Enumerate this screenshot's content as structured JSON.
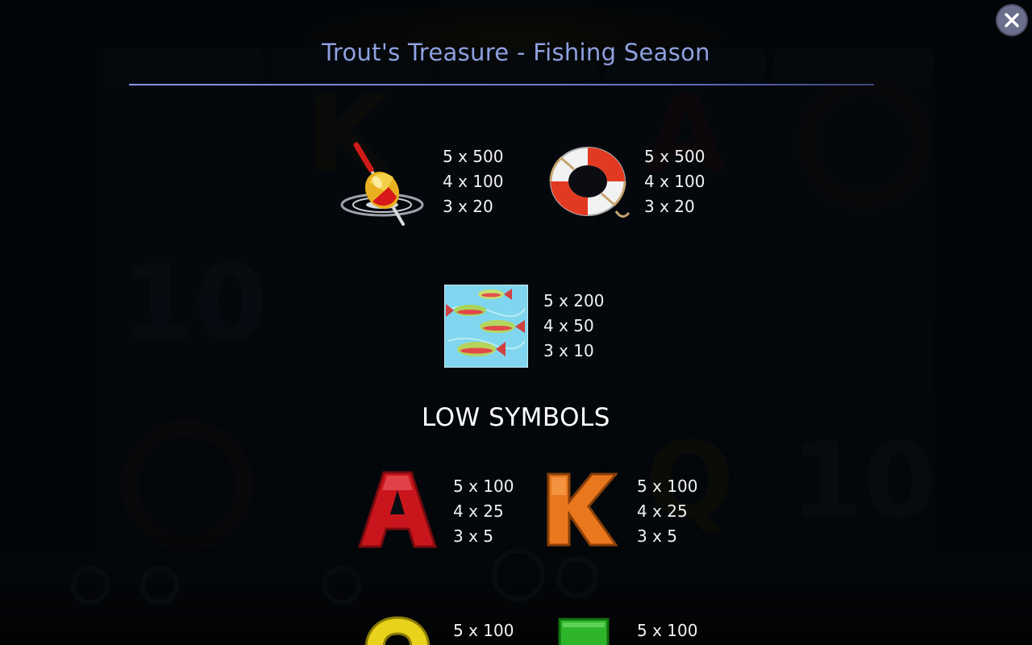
{
  "game": {
    "title": "Trout's Treasure - Fishing Season",
    "close_icon": "close-icon"
  },
  "high_symbols": [
    {
      "icon": "fishing-float-icon",
      "pays": [
        "5 x 500",
        "4 x 100",
        "3 x 20"
      ]
    },
    {
      "icon": "lifebuoy-icon",
      "pays": [
        "5 x 500",
        "4 x 100",
        "3 x 20"
      ]
    },
    {
      "icon": "trout-fish-icon",
      "pays": [
        "5 x 200",
        "4 x 50",
        "3 x 10"
      ]
    }
  ],
  "low_section": {
    "title": "LOW SYMBOLS"
  },
  "low_symbols": [
    {
      "letter": "A",
      "color": "#c8161c",
      "pays": [
        "5 x 100",
        "4 x 25",
        "3 x 5"
      ]
    },
    {
      "letter": "K",
      "color": "#e8771e",
      "pays": [
        "5 x 100",
        "4 x 25",
        "3 x 5"
      ]
    },
    {
      "letter": "Q",
      "color": "#e8d21c",
      "pays": [
        "5 x 100"
      ]
    },
    {
      "letter": "J",
      "color": "#2fb52a",
      "pays": [
        "5 x 100"
      ]
    }
  ],
  "colors": {
    "title": "#8fa0e0",
    "rule": "#7a80d8",
    "overlay": "rgba(0,0,0,0.72)"
  }
}
